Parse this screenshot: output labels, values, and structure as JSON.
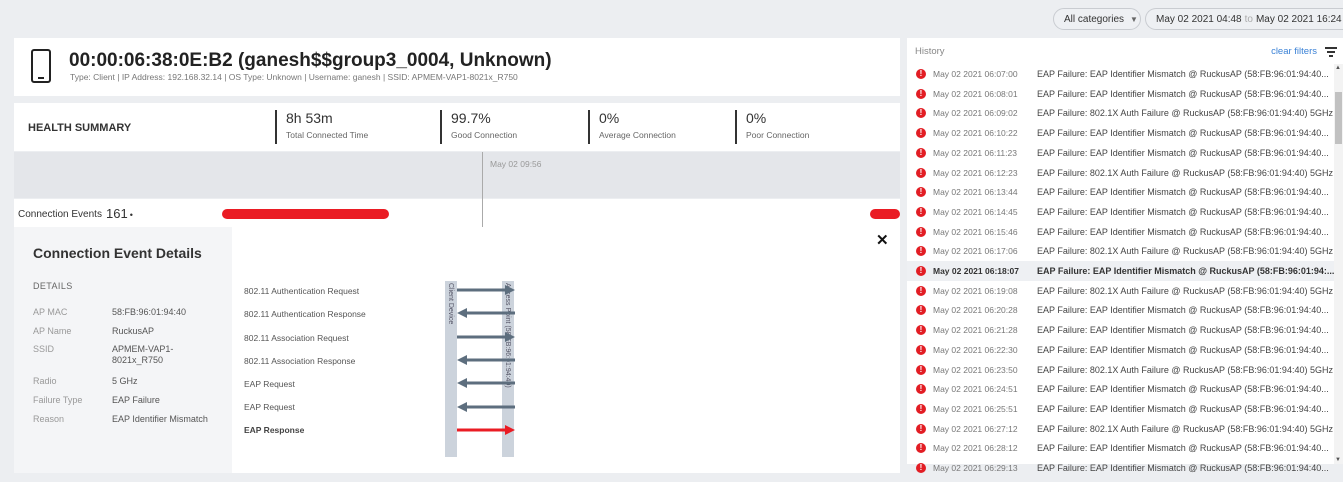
{
  "filters": {
    "category": "All categories",
    "date_from": "May 02 2021 04:48",
    "date_sep": "to",
    "date_to": "May 02 2021 16:24"
  },
  "client": {
    "title": "00:00:06:38:0E:B2 (ganesh$$group3_0004, Unknown)",
    "subtitle": "Type: Client  |  IP Address: 192.168.32.14  |  OS Type: Unknown  |  Username: ganesh  |  SSID: APMEM-VAP1-8021x_R750",
    "icon": "phone-icon"
  },
  "health": {
    "label": "HEALTH SUMMARY",
    "metrics": [
      {
        "value": "8h 53m",
        "label": "Total Connected Time"
      },
      {
        "value": "99.7%",
        "label": "Good Connection"
      },
      {
        "value": "0%",
        "label": "Average Connection"
      },
      {
        "value": "0%",
        "label": "Poor Connection"
      }
    ]
  },
  "timeline": {
    "marker_date": "May 02 09:56",
    "connection_events_label": "Connection Events",
    "connection_events_count": "161",
    "bar_color": "#ea1c24"
  },
  "details": {
    "title": "Connection Event Details",
    "section": "DETAILS",
    "rows": [
      {
        "key": "AP MAC",
        "value": "58:FB:96:01:94:40"
      },
      {
        "key": "AP Name",
        "value": "RuckusAP"
      },
      {
        "key": "SSID",
        "value": "APMEM-VAP1-8021x_R750"
      },
      {
        "key": "Radio",
        "value": "5 GHz"
      },
      {
        "key": "Failure Type",
        "value": "EAP Failure"
      },
      {
        "key": "Reason",
        "value": "EAP Identifier Mismatch"
      }
    ],
    "close_icon": "close-icon",
    "lane_client": "Client Device",
    "lane_ap": "Access Point (58:FB:96:01:94:40)",
    "steps": [
      {
        "label": "802.11 Authentication Request",
        "direction": "right",
        "status": "ok"
      },
      {
        "label": "802.11 Authentication Response",
        "direction": "left",
        "status": "ok"
      },
      {
        "label": "802.11 Association Request",
        "direction": "right",
        "status": "ok"
      },
      {
        "label": "802.11 Association Response",
        "direction": "left",
        "status": "ok"
      },
      {
        "label": "EAP Request",
        "direction": "left",
        "status": "ok"
      },
      {
        "label": "EAP Request",
        "direction": "left",
        "status": "ok"
      },
      {
        "label": "EAP Response",
        "direction": "right",
        "status": "fail"
      }
    ],
    "arrow_ok_color": "#5d6e7e",
    "arrow_fail_color": "#ea1c24"
  },
  "history": {
    "title": "History",
    "clear_filters": "clear filters",
    "filter_icon": "filter-icon",
    "status_color": "#e21d24",
    "items": [
      {
        "time": "May 02 2021 06:07:00",
        "text": "EAP Failure: EAP Identifier Mismatch @ RuckusAP (58:FB:96:01:94:40..."
      },
      {
        "time": "May 02 2021 06:08:01",
        "text": "EAP Failure: EAP Identifier Mismatch @ RuckusAP (58:FB:96:01:94:40..."
      },
      {
        "time": "May 02 2021 06:09:02",
        "text": "EAP Failure: 802.1X Auth Failure @ RuckusAP (58:FB:96:01:94:40) 5GHz"
      },
      {
        "time": "May 02 2021 06:10:22",
        "text": "EAP Failure: EAP Identifier Mismatch @ RuckusAP (58:FB:96:01:94:40..."
      },
      {
        "time": "May 02 2021 06:11:23",
        "text": "EAP Failure: EAP Identifier Mismatch @ RuckusAP (58:FB:96:01:94:40..."
      },
      {
        "time": "May 02 2021 06:12:23",
        "text": "EAP Failure: 802.1X Auth Failure @ RuckusAP (58:FB:96:01:94:40) 5GHz"
      },
      {
        "time": "May 02 2021 06:13:44",
        "text": "EAP Failure: EAP Identifier Mismatch @ RuckusAP (58:FB:96:01:94:40..."
      },
      {
        "time": "May 02 2021 06:14:45",
        "text": "EAP Failure: EAP Identifier Mismatch @ RuckusAP (58:FB:96:01:94:40..."
      },
      {
        "time": "May 02 2021 06:15:46",
        "text": "EAP Failure: EAP Identifier Mismatch @ RuckusAP (58:FB:96:01:94:40..."
      },
      {
        "time": "May 02 2021 06:17:06",
        "text": "EAP Failure: 802.1X Auth Failure @ RuckusAP (58:FB:96:01:94:40) 5GHz"
      },
      {
        "time": "May 02 2021 06:18:07",
        "text": "EAP Failure: EAP Identifier Mismatch @ RuckusAP (58:FB:96:01:94:...",
        "selected": true
      },
      {
        "time": "May 02 2021 06:19:08",
        "text": "EAP Failure: 802.1X Auth Failure @ RuckusAP (58:FB:96:01:94:40) 5GHz"
      },
      {
        "time": "May 02 2021 06:20:28",
        "text": "EAP Failure: EAP Identifier Mismatch @ RuckusAP (58:FB:96:01:94:40..."
      },
      {
        "time": "May 02 2021 06:21:28",
        "text": "EAP Failure: EAP Identifier Mismatch @ RuckusAP (58:FB:96:01:94:40..."
      },
      {
        "time": "May 02 2021 06:22:30",
        "text": "EAP Failure: EAP Identifier Mismatch @ RuckusAP (58:FB:96:01:94:40..."
      },
      {
        "time": "May 02 2021 06:23:50",
        "text": "EAP Failure: 802.1X Auth Failure @ RuckusAP (58:FB:96:01:94:40) 5GHz"
      },
      {
        "time": "May 02 2021 06:24:51",
        "text": "EAP Failure: EAP Identifier Mismatch @ RuckusAP (58:FB:96:01:94:40..."
      },
      {
        "time": "May 02 2021 06:25:51",
        "text": "EAP Failure: EAP Identifier Mismatch @ RuckusAP (58:FB:96:01:94:40..."
      },
      {
        "time": "May 02 2021 06:27:12",
        "text": "EAP Failure: 802.1X Auth Failure @ RuckusAP (58:FB:96:01:94:40) 5GHz"
      },
      {
        "time": "May 02 2021 06:28:12",
        "text": "EAP Failure: EAP Identifier Mismatch @ RuckusAP (58:FB:96:01:94:40..."
      },
      {
        "time": "May 02 2021 06:29:13",
        "text": "EAP Failure: EAP Identifier Mismatch @ RuckusAP (58:FB:96:01:94:40..."
      }
    ]
  }
}
